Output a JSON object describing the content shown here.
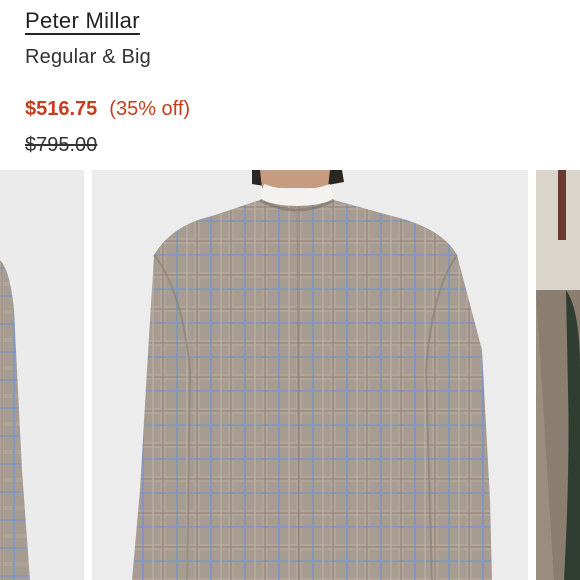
{
  "product": {
    "brand": "Peter Millar",
    "fit": "Regular & Big",
    "sale_price": "$516.75",
    "discount": "(35% off)",
    "original_price": "$795.00"
  },
  "colors": {
    "sale": "#c53d1e",
    "jacket": "#a69c92",
    "plaid_blue": "#7e95c4"
  },
  "gallery": {
    "images": [
      "jacket-side-view",
      "jacket-back-view",
      "jacket-lifestyle-view"
    ]
  }
}
